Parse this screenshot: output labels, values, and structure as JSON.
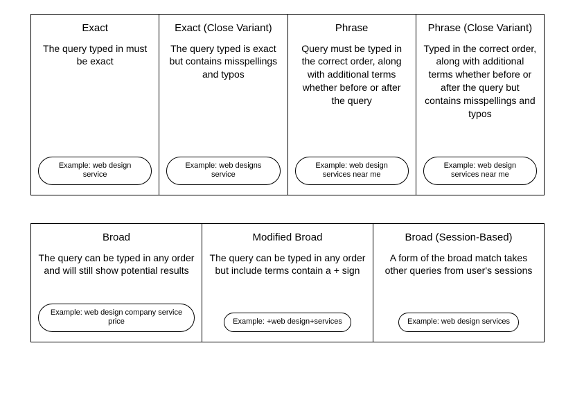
{
  "rows": [
    {
      "cells": [
        {
          "title": "Exact",
          "desc": "The query typed in must be exact",
          "example": "Example: web design service"
        },
        {
          "title": "Exact (Close Variant)",
          "desc": "The query typed is exact but contains misspellings and typos",
          "example": "Example: web designs service"
        },
        {
          "title": "Phrase",
          "desc": "Query must be typed in the correct order, along with additional terms whether before or after the query",
          "example": "Example: web design services near me"
        },
        {
          "title": "Phrase (Close Variant)",
          "desc": "Typed in the correct order, along with additional terms whether before or after the query but contains misspellings and typos",
          "example": "Example: web design services near me"
        }
      ]
    },
    {
      "cells": [
        {
          "title": "Broad",
          "desc": "The query can be typed in any order and will still show potential results",
          "example": "Example: web design company service price"
        },
        {
          "title": "Modified Broad",
          "desc": "The query can be typed in any order but include terms contain a + sign",
          "example": "Example: +web design+services"
        },
        {
          "title": "Broad (Session-Based)",
          "desc": "A form of the broad match takes other queries from user's sessions",
          "example": "Example: web design services"
        }
      ]
    }
  ]
}
